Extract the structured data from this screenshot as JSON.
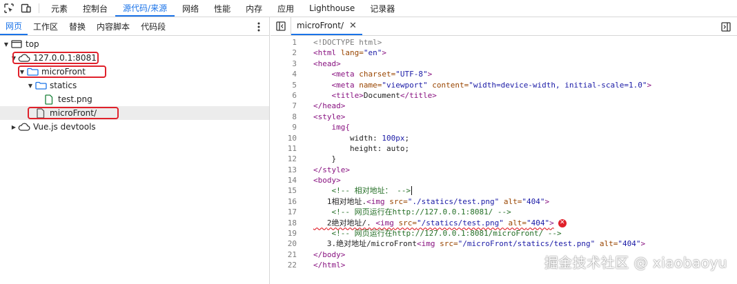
{
  "topbar": {
    "tabs": [
      "元素",
      "控制台",
      "源代码/来源",
      "网络",
      "性能",
      "内存",
      "应用",
      "Lighthouse",
      "记录器"
    ],
    "active_tab": "源代码/来源"
  },
  "navigator": {
    "tabs": [
      "网页",
      "工作区",
      "替换",
      "内容脚本",
      "代码段"
    ],
    "tree": {
      "top": "top",
      "host": "127.0.0.1:8081",
      "folder": "microFront",
      "subfolder": "statics",
      "file_png": "test.png",
      "file_doc": "microFront/",
      "devtools": "Vue.js devtools"
    }
  },
  "editor": {
    "open_file": "microFront/",
    "line_numbers": [
      "1",
      "2",
      "3",
      "4",
      "5",
      "6",
      "7",
      "8",
      "9",
      "10",
      "11",
      "12",
      "13",
      "14",
      "15",
      "16",
      "17",
      "18",
      "19",
      "20",
      "21",
      "22"
    ],
    "code": {
      "l1": "<!DOCTYPE html>",
      "l2_tag": "<html",
      "l2_attr": " lang=",
      "l2_val": "\"en\"",
      "l2_end": ">",
      "l3": "<head>",
      "l4_tag": "<meta",
      "l4_attr": " charset=",
      "l4_val": "\"UTF-8\"",
      "l4_end": ">",
      "l5_tag": "<meta",
      "l5_attr1": " name=",
      "l5_val1": "\"viewport\"",
      "l5_attr2": " content=",
      "l5_val2": "\"width=device-width, initial-scale=1.0\"",
      "l5_end": ">",
      "l6_open": "<title>",
      "l6_text": "Document",
      "l6_close": "</title>",
      "l7": "</head>",
      "l8": "<style>",
      "l9": "img{",
      "l10_prop": "width: ",
      "l10_val": "100px",
      "l10_end": ";",
      "l11": "height: auto;",
      "l12": "}",
      "l13": "</style>",
      "l14": "<body>",
      "l15": "<!-- 相对地址： -->",
      "l16_text": "1相对地址.",
      "l16_tag": "<img",
      "l16_attr1": " src=",
      "l16_val1": "\"./statics/test.png\"",
      "l16_attr2": " alt=",
      "l16_val2": "\"404\"",
      "l16_end": ">",
      "l17": "<!-- 网页运行在http://127.0.0.1:8081/ -->",
      "l18_text": "2绝对地址/. ",
      "l18_tag": "<img",
      "l18_attr1": " src=",
      "l18_val1": "\"/statics/test.png\"",
      "l18_attr2": " alt=",
      "l18_val2": "\"404\"",
      "l18_end": ">",
      "l19": "<!-- 网页运行在http://127.0.0.1:8081/microFront/ -->",
      "l20_text": "3.绝对地址/microFront",
      "l20_tag": "<img",
      "l20_attr1": " src=",
      "l20_val1": "\"/microFront/statics/test.png\"",
      "l20_attr2": " alt=",
      "l20_val2": "\"404\"",
      "l20_end": ">",
      "l21": "</body>",
      "l22": "</html>"
    },
    "error_glyph": "✕"
  },
  "watermark": "掘金技术社区 @ xiaobaoyu",
  "colors": {
    "accent": "#1a73e8",
    "highlight": "#e0202a"
  }
}
